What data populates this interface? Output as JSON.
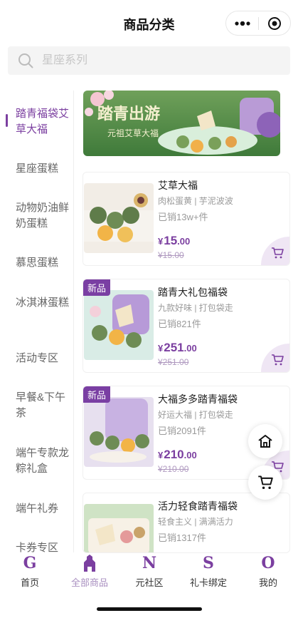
{
  "header": {
    "title": "商品分类"
  },
  "search": {
    "placeholder": "星座系列"
  },
  "sidebar": {
    "items": [
      {
        "label": "踏青福袋艾草大福",
        "active": true
      },
      {
        "label": "星座蛋糕"
      },
      {
        "label": "动物奶油鲜奶蛋糕"
      },
      {
        "label": "慕思蛋糕"
      },
      {
        "label": "冰淇淋蛋糕"
      },
      {
        "label": "活动专区"
      },
      {
        "label": "早餐&下午茶"
      },
      {
        "label": "端午专款龙粽礼盒"
      },
      {
        "label": "端午礼券"
      },
      {
        "label": "卡券专区"
      }
    ]
  },
  "banner": {
    "title": "踏青出游",
    "subtitle": "元祖艾草大福"
  },
  "products": [
    {
      "name": "艾草大福",
      "tags": "肉松蛋黄 | 芋泥波波",
      "sold": "已销13w+件",
      "yen": "¥",
      "price_int": "15",
      "price_dec": ".00",
      "original": "¥15.00",
      "badge": ""
    },
    {
      "name": "踏青大礼包福袋",
      "tags": "九款好味 | 打包袋走",
      "sold": "已销821件",
      "yen": "¥",
      "price_int": "251",
      "price_dec": ".00",
      "original": "¥251.00",
      "badge": "新品"
    },
    {
      "name": "大福多多踏青福袋",
      "tags": "好运大福 | 打包袋走",
      "sold": "已销2091件",
      "yen": "¥",
      "price_int": "210",
      "price_dec": ".00",
      "original": "¥210.00",
      "badge": "新品"
    },
    {
      "name": "活力轻食踏青福袋",
      "tags": "轻食主义 | 满满活力",
      "sold": "已销1317件",
      "yen": "",
      "price_int": "",
      "price_dec": "",
      "original": "",
      "badge": ""
    }
  ],
  "tabbar": {
    "items": [
      {
        "glyph": "G",
        "label": "首页"
      },
      {
        "glyph": "A",
        "label": "全部商品",
        "active": true
      },
      {
        "glyph": "N",
        "label": "元社区"
      },
      {
        "glyph": "S",
        "label": "礼卡绑定"
      },
      {
        "glyph": "O",
        "label": "我的"
      }
    ]
  },
  "colors": {
    "accent": "#7b3fa0",
    "accent_light": "#efe6f4",
    "badge": "#7a3fa3"
  },
  "icons": {
    "search": "search-icon",
    "more": "more-dots-icon",
    "target": "target-icon",
    "cart": "cart-icon",
    "home": "home-icon"
  }
}
